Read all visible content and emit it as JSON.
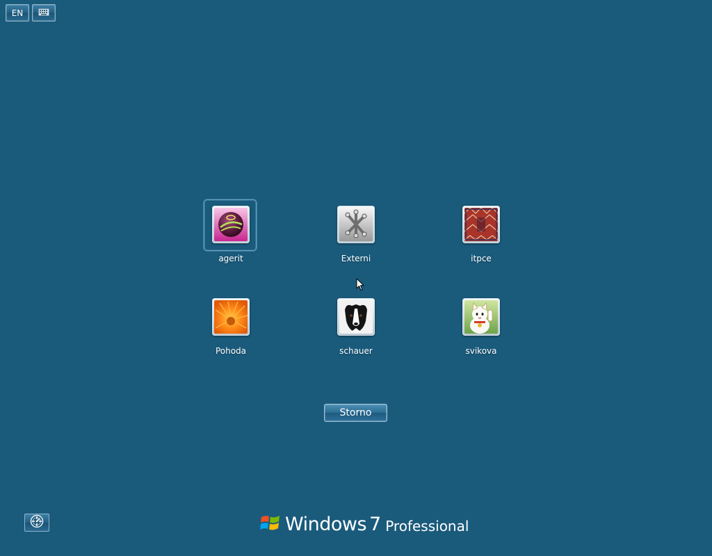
{
  "toolbar": {
    "language_label": "EN",
    "keyboard_icon": "keyboard-icon"
  },
  "users": [
    {
      "name": "agerit",
      "picture": "ball",
      "selected": true
    },
    {
      "name": "Externi",
      "picture": "jacks",
      "selected": false
    },
    {
      "name": "itpce",
      "picture": "carpet",
      "selected": false
    },
    {
      "name": "Pohoda",
      "picture": "flower",
      "selected": false
    },
    {
      "name": "schauer",
      "picture": "dog",
      "selected": false
    },
    {
      "name": "svikova",
      "picture": "cat",
      "selected": false
    }
  ],
  "actions": {
    "cancel_label": "Storno"
  },
  "footer": {
    "ease_icon": "ease-of-access-icon",
    "brand_word": "Windows",
    "brand_version": "7",
    "brand_edition": "Professional"
  },
  "colors": {
    "background": "#1a5b7c",
    "text": "#ffffff"
  }
}
